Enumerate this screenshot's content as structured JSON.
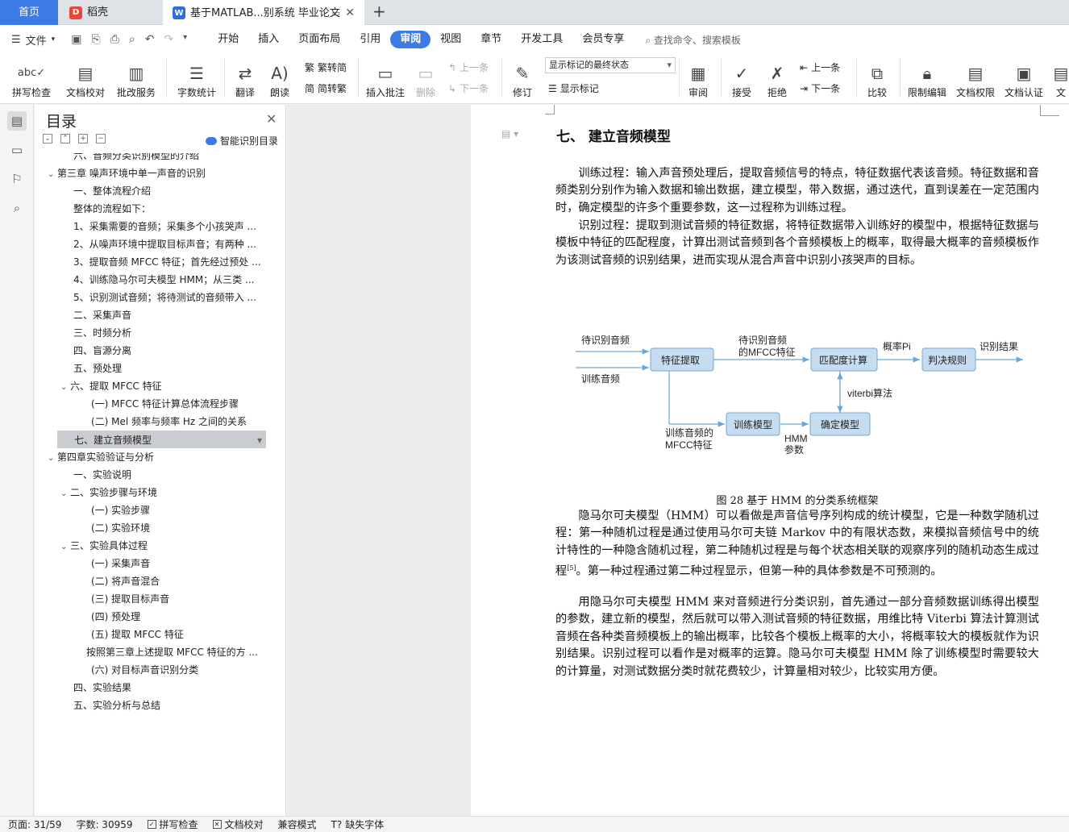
{
  "tabs": {
    "home": "首页",
    "daoke": "稻壳",
    "doc": "基于MATLAB...别系统 毕业论文"
  },
  "menu": {
    "file": "文件",
    "tabs": [
      "开始",
      "插入",
      "页面布局",
      "引用",
      "审阅",
      "视图",
      "章节",
      "开发工具",
      "会员专享"
    ],
    "active_tab": "审阅",
    "search": "查找命令、搜索模板"
  },
  "ribbon": {
    "spell": "拼写检查",
    "proof": "文档校对",
    "batch": "批改服务",
    "wordcount": "字数统计",
    "translate": "翻译",
    "read": "朗读",
    "to_trad": "繁转简",
    "to_simp": "简转繁",
    "insert_comment": "插入批注",
    "delete": "删除",
    "prev": "上一条",
    "next": "下一条",
    "track": "修订",
    "markup_select": "显示标记的最终状态",
    "show_markup": "显示标记",
    "review": "审阅",
    "accept": "接受",
    "reject": "拒绝",
    "prev2": "上一条",
    "next2": "下一条",
    "compare": "比较",
    "restrict": "限制编辑",
    "permission": "文档权限",
    "certify": "文档认证",
    "more": "文"
  },
  "nav": {
    "title": "目录",
    "smart": "智能识别目录",
    "items": [
      {
        "text": "六、音频分类识别模型的介绍",
        "level": 2,
        "arrow": ""
      },
      {
        "text": "第三章 噪声环境中单一声音的识别",
        "level": 0,
        "arrow": "⌄"
      },
      {
        "text": "一、整体流程介绍",
        "level": 2,
        "arrow": ""
      },
      {
        "text": "整体的流程如下：",
        "level": 2,
        "arrow": ""
      },
      {
        "text": "1、采集需要的音频；采集多个小孩哭声 ...",
        "level": 2,
        "arrow": ""
      },
      {
        "text": "2、从噪声环境中提取目标声音；有两种 ...",
        "level": 2,
        "arrow": ""
      },
      {
        "text": "3、提取音频 MFCC 特征；首先经过预处 ...",
        "level": 2,
        "arrow": ""
      },
      {
        "text": "4、训练隐马尔可夫模型 HMM；从三类 ...",
        "level": 2,
        "arrow": ""
      },
      {
        "text": "5、识别测试音频；将待测试的音频带入 ...",
        "level": 2,
        "arrow": ""
      },
      {
        "text": "二、采集声音",
        "level": 2,
        "arrow": ""
      },
      {
        "text": "三、时频分析",
        "level": 2,
        "arrow": ""
      },
      {
        "text": "四、盲源分离",
        "level": 2,
        "arrow": ""
      },
      {
        "text": "五、预处理",
        "level": 2,
        "arrow": ""
      },
      {
        "text": "六、提取 MFCC 特征",
        "level": 1,
        "arrow": "⌄"
      },
      {
        "text": "(一) MFCC 特征计算总体流程步骤",
        "level": 3,
        "arrow": ""
      },
      {
        "text": "(二) Mel 频率与频率 Hz 之间的关系",
        "level": 3,
        "arrow": ""
      },
      {
        "text": "七、建立音频模型",
        "level": 2,
        "arrow": "",
        "selected": true
      },
      {
        "text": "第四章实验验证与分析",
        "level": 0,
        "arrow": "⌄"
      },
      {
        "text": "一、实验说明",
        "level": 2,
        "arrow": ""
      },
      {
        "text": "二、实验步骤与环境",
        "level": 1,
        "arrow": "⌄"
      },
      {
        "text": "(一) 实验步骤",
        "level": 3,
        "arrow": ""
      },
      {
        "text": "(二) 实验环境",
        "level": 3,
        "arrow": ""
      },
      {
        "text": "三、实验具体过程",
        "level": 1,
        "arrow": "⌄"
      },
      {
        "text": "(一) 采集声音",
        "level": 3,
        "arrow": ""
      },
      {
        "text": "(二) 将声音混合",
        "level": 3,
        "arrow": ""
      },
      {
        "text": "(三) 提取目标声音",
        "level": 3,
        "arrow": ""
      },
      {
        "text": "(四) 预处理",
        "level": 3,
        "arrow": ""
      },
      {
        "text": "(五) 提取 MFCC 特征",
        "level": 3,
        "arrow": ""
      },
      {
        "text": "按照第三章上述提取 MFCC 特征的方 ...",
        "level": 4,
        "arrow": ""
      },
      {
        "text": "(六) 对目标声音识别分类",
        "level": 3,
        "arrow": ""
      },
      {
        "text": "四、实验结果",
        "level": 2,
        "arrow": ""
      },
      {
        "text": "五、实验分析与总结",
        "level": 2,
        "arrow": ""
      }
    ]
  },
  "doc": {
    "heading": "七、  建立音频模型",
    "p1": "训练过程：输入声音预处理后，提取音频信号的特点，特征数据代表该音频。特征数据和音频类别分别作为输入数据和输出数据，建立模型，带入数据，通过迭代，直到误差在一定范围内时，确定模型的许多个重要参数，这一过程称为训练过程。",
    "p2": "识别过程：提取到测试音频的特征数据，将特征数据带入训练好的模型中，根据特征数据与模板中特征的匹配程度，计算出测试音频到各个音频模板上的概率，取得最大概率的音频模板作为该测试音频的识别结果，进而实现从混合声音中识别小孩哭声的目标。",
    "diagram": {
      "in1": "待识别音频",
      "in2": "训练音频",
      "feat": "特征提取",
      "lbl_mfcc1": "待识别音频",
      "lbl_mfcc2": "的MFCC特征",
      "match": "匹配度计算",
      "prob": "概率Pi",
      "judge": "判决规则",
      "result": "识别结果",
      "viterbi": "viterbi算法",
      "train": "训练模型",
      "confirm": "确定模型",
      "lbl_train1": "训练音频的",
      "lbl_train2": "MFCC特征",
      "hmm1": "HMM",
      "hmm2": "参数"
    },
    "caption": "图 28 基于 HMM 的分类系统框架",
    "p3a": "隐马尔可夫模型（HMM）可以看做是声音信号序列构成的统计模型，它是一种数学随机过程：第一种随机过程是通过使用马尔可夫链 Markov 中的有限状态数，来模拟音频信号中的统计特性的一种隐含随机过程，第二种随机过程是与每个状态相关联的观察序列的随机动态生成过程",
    "p3ref": "[5]",
    "p3b": "。第一种过程通过第二种过程显示，但第一种的具体参数是不可预测的。",
    "p4": "用隐马尔可夫模型 HMM 来对音频进行分类识别，首先通过一部分音频数据训练得出模型的参数，建立新的模型，然后就可以带入测试音频的特征数据，用维比特 Viterbi 算法计算测试音频在各种类音频模板上的输出概率，比较各个模板上概率的大小，将概率较大的模板就作为识别结果。识别过程可以看作是对概率的运算。隐马尔可夫模型 HMM 除了训练模型时需要较大的计算量，对测试数据分类时就花费较少，计算量相对较少，比较实用方便。"
  },
  "status": {
    "page": "页面: 31/59",
    "words": "字数: 30959",
    "spell": "拼写检查",
    "proof": "文档校对",
    "compat": "兼容模式",
    "font": "缺失字体"
  }
}
